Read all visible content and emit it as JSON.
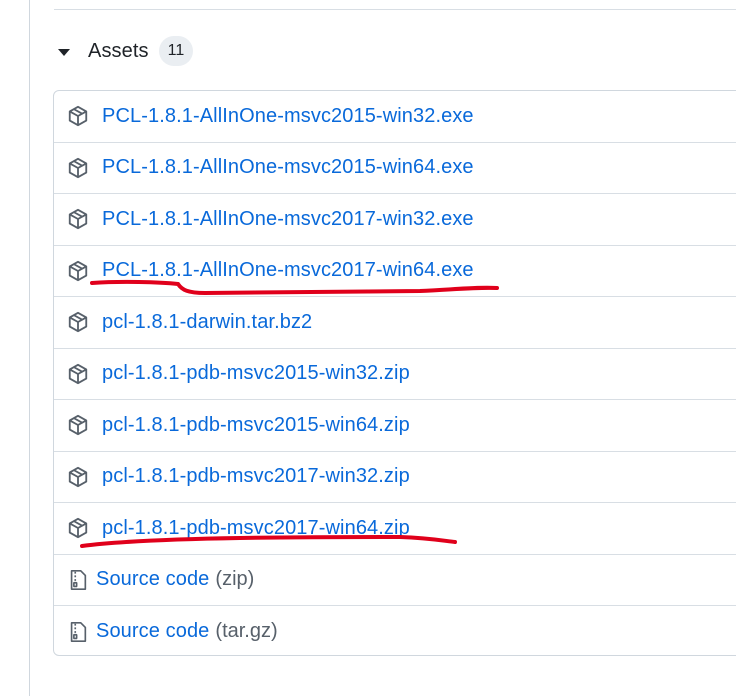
{
  "assets": {
    "title": "Assets",
    "count": "11",
    "files": [
      {
        "name": "PCL-1.8.1-AllInOne-msvc2015-win32.exe",
        "icon": "package-icon"
      },
      {
        "name": "PCL-1.8.1-AllInOne-msvc2015-win64.exe",
        "icon": "package-icon"
      },
      {
        "name": "PCL-1.8.1-AllInOne-msvc2017-win32.exe",
        "icon": "package-icon"
      },
      {
        "name": "PCL-1.8.1-AllInOne-msvc2017-win64.exe",
        "icon": "package-icon"
      },
      {
        "name": "pcl-1.8.1-darwin.tar.bz2",
        "icon": "package-icon"
      },
      {
        "name": "pcl-1.8.1-pdb-msvc2015-win32.zip",
        "icon": "package-icon"
      },
      {
        "name": "pcl-1.8.1-pdb-msvc2015-win64.zip",
        "icon": "package-icon"
      },
      {
        "name": "pcl-1.8.1-pdb-msvc2017-win32.zip",
        "icon": "package-icon"
      },
      {
        "name": "pcl-1.8.1-pdb-msvc2017-win64.zip",
        "icon": "package-icon"
      }
    ],
    "source_code": [
      {
        "label": "Source code",
        "format": "(zip)",
        "icon": "file-zip-icon"
      },
      {
        "label": "Source code",
        "format": "(tar.gz)",
        "icon": "file-zip-icon"
      }
    ]
  },
  "colors": {
    "link": "#0969da",
    "annotation": "#e0001b",
    "border": "#d0d7de"
  }
}
